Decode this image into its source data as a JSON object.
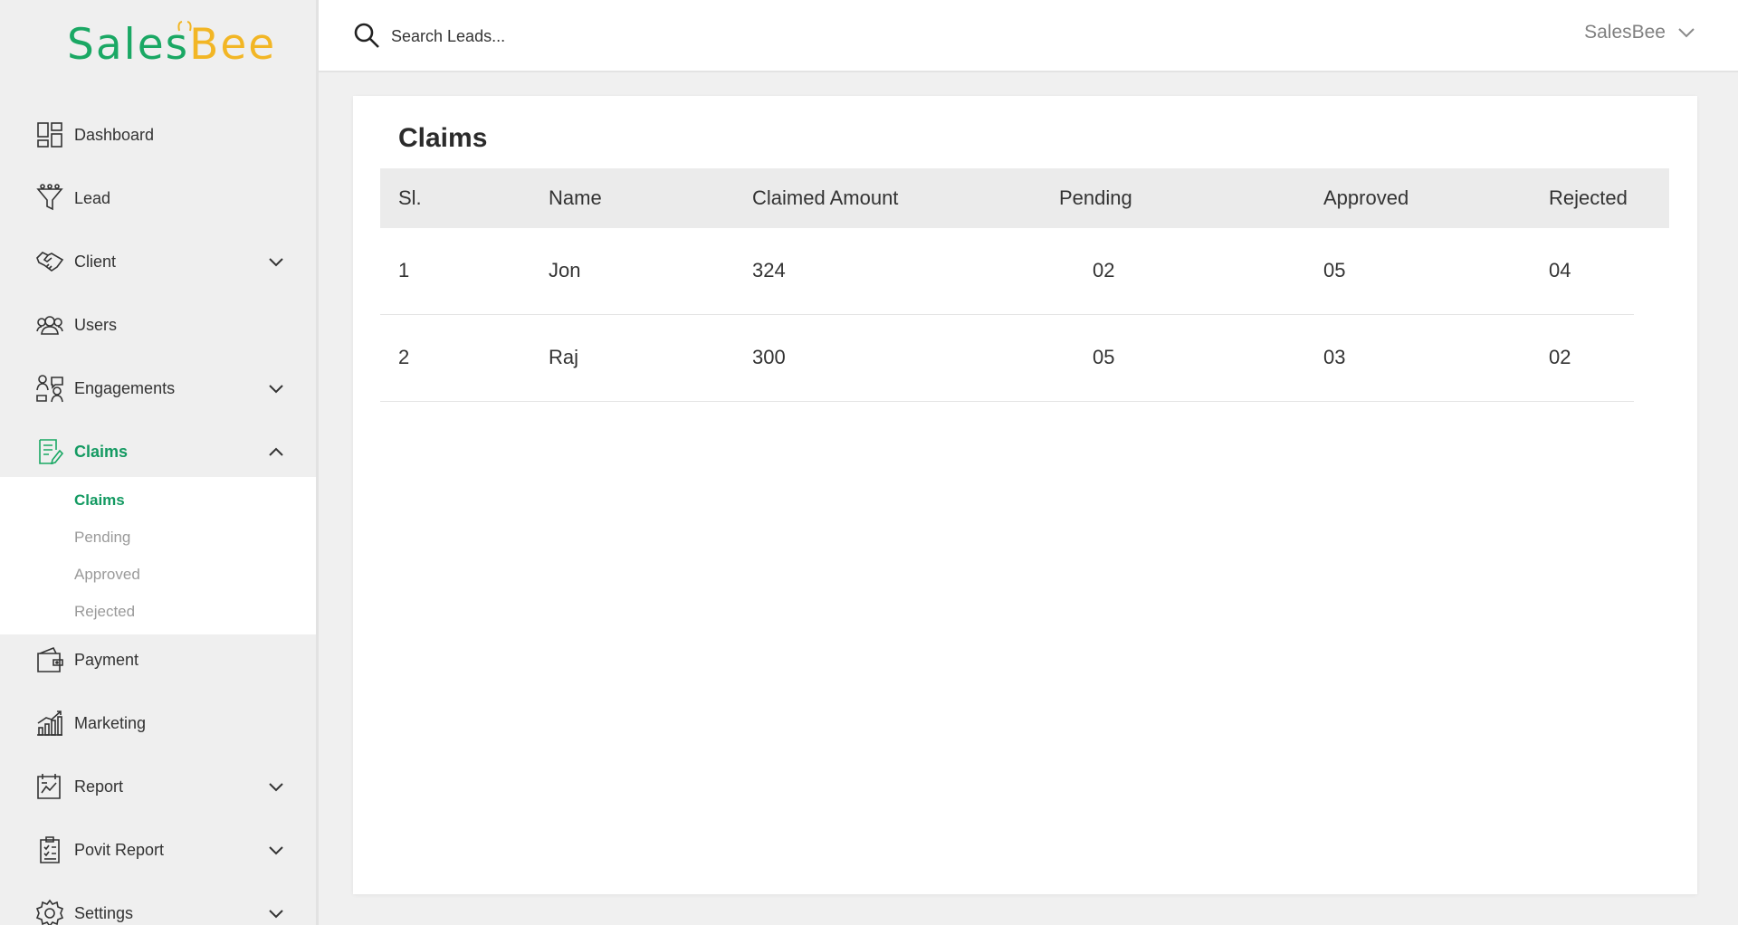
{
  "brand": {
    "logo_left": "Sales",
    "logo_b": "B",
    "logo_right": "ee",
    "green": "#1aa864",
    "yellow": "#f2b625"
  },
  "sidebar": {
    "items": [
      {
        "label": "Dashboard",
        "icon": "dashboard-icon"
      },
      {
        "label": "Lead",
        "icon": "funnel-icon"
      },
      {
        "label": "Client",
        "icon": "handshake-icon"
      },
      {
        "label": "Users",
        "icon": "users-icon"
      },
      {
        "label": "Engagements",
        "icon": "engagements-icon"
      },
      {
        "label": "Claims",
        "icon": "claims-icon"
      },
      {
        "label": "Payment",
        "icon": "wallet-icon"
      },
      {
        "label": "Marketing",
        "icon": "bar-chart-icon"
      },
      {
        "label": "Report",
        "icon": "report-icon"
      },
      {
        "label": "Povit Report",
        "icon": "clipboard-icon"
      },
      {
        "label": "Settings",
        "icon": "gear-icon"
      }
    ],
    "claims_submenu": [
      "Claims",
      "Pending",
      "Approved",
      "Rejected"
    ],
    "active_color": "#149a62"
  },
  "header": {
    "search_placeholder": "Search Leads...",
    "user_name": "SalesBee"
  },
  "main": {
    "title": "Claims",
    "columns": [
      "Sl.",
      "Name",
      "Claimed Amount",
      "Pending",
      "Approved",
      "Rejected"
    ],
    "rows": [
      [
        "1",
        "Jon",
        "324",
        "02",
        "05",
        "04"
      ],
      [
        "2",
        "Raj",
        "300",
        "05",
        "03",
        "02"
      ]
    ]
  }
}
